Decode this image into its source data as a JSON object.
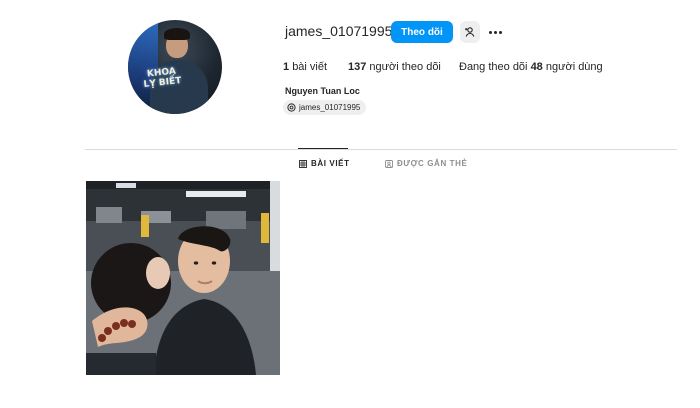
{
  "profile": {
    "username": "james_01071995",
    "full_name": "Nguyen Tuan Loc",
    "follow_label": "Theo dõi",
    "threads_handle": "james_01071995",
    "avatar_sign_text": "KHOA LỴ BIẾT"
  },
  "stats": {
    "posts_count": "1",
    "posts_label": "bài viết",
    "followers_count": "137",
    "followers_label": "người theo dõi",
    "following_prefix": "Đang theo dõi",
    "following_count": "48",
    "following_label": "người dùng"
  },
  "tabs": [
    {
      "label": "BÀI VIẾT",
      "active": true,
      "icon": "grid-icon"
    },
    {
      "label": "ĐƯỢC GẮN THẺ",
      "active": false,
      "icon": "tagged-icon"
    }
  ],
  "icons": {
    "suggest": "person-add-icon",
    "more": "more-options-icon",
    "threads": "threads-icon"
  },
  "colors": {
    "primary_button": "#0095f6",
    "secondary_button": "#efefef",
    "text": "#262626",
    "muted_text": "#8e8e8e",
    "divider": "#dbdbdb"
  },
  "posts": [
    {
      "type": "photo",
      "subject": "couple-selfie-in-parking-garage"
    }
  ]
}
